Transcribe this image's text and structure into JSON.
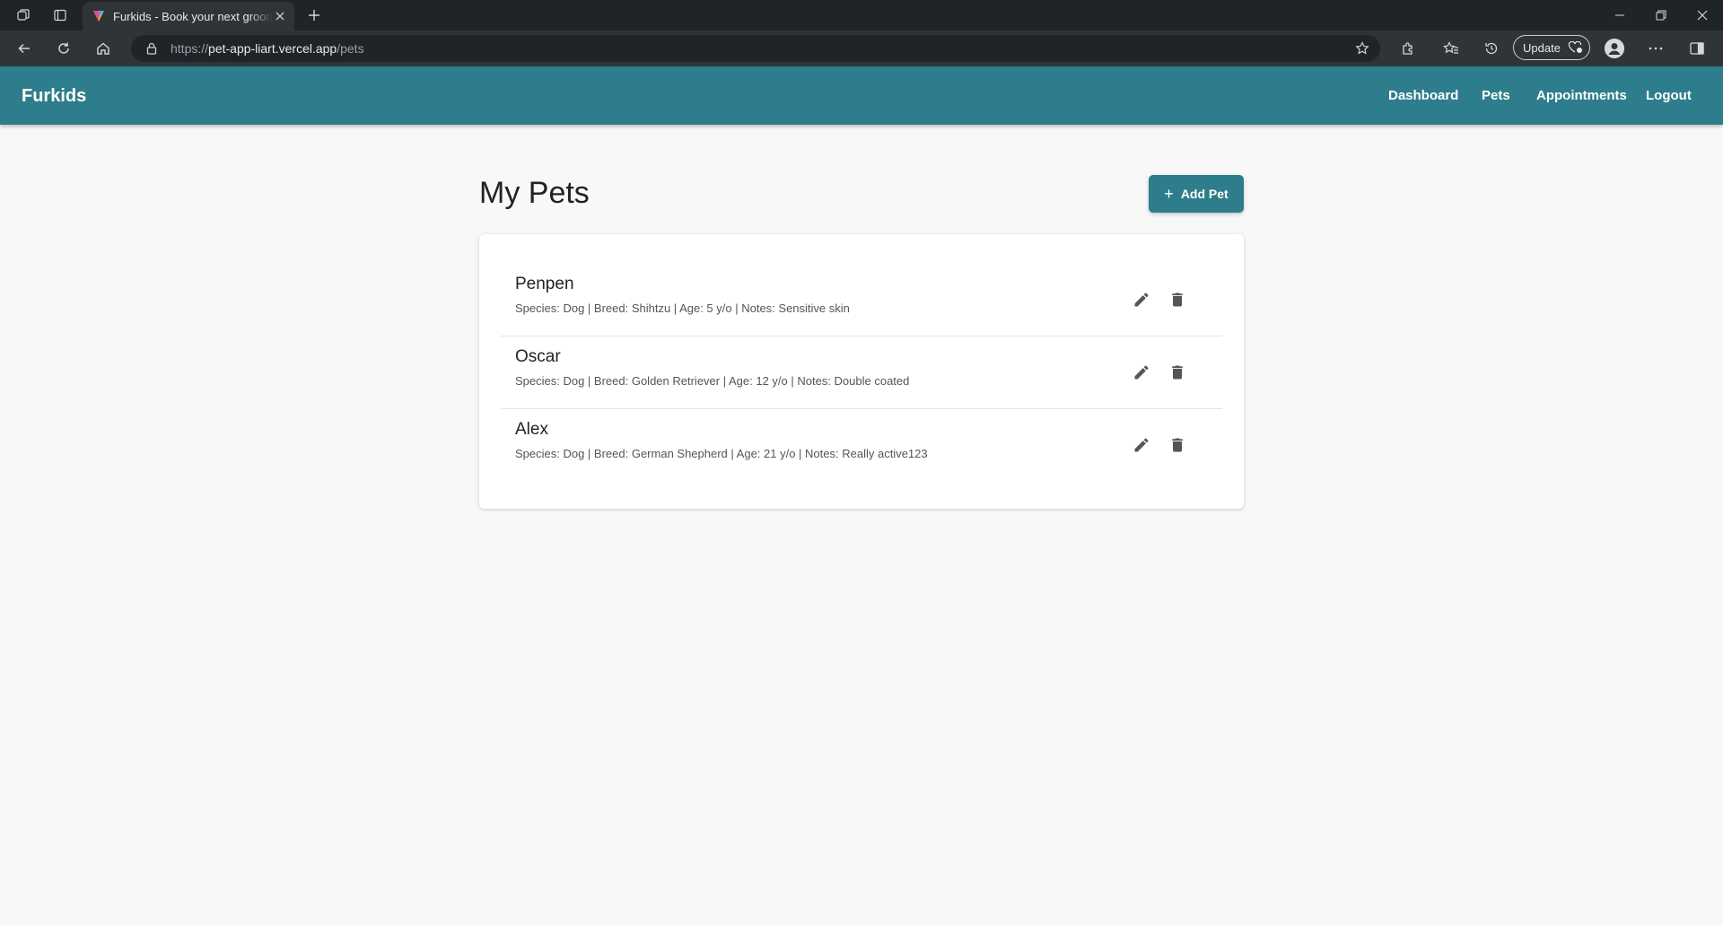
{
  "browser": {
    "tab_title": "Furkids - Book your next grooming appointment",
    "url_prefix": "https://",
    "url_host": "pet-app-liart.vercel.app",
    "url_path": "/pets",
    "update_label": "Update"
  },
  "navbar": {
    "brand": "Furkids",
    "links": [
      "Dashboard",
      "Pets",
      "Appointments",
      "Logout"
    ]
  },
  "page": {
    "title": "My Pets",
    "add_button_label": "Add Pet"
  },
  "pets": [
    {
      "name": "Penpen",
      "details": "Species: Dog | Breed: Shihtzu | Age: 5 y/o | Notes: Sensitive skin"
    },
    {
      "name": "Oscar",
      "details": "Species: Dog | Breed: Golden Retriever | Age: 12 y/o | Notes: Double coated"
    },
    {
      "name": "Alex",
      "details": "Species: Dog | Breed: German Shepherd | Age: 21 y/o | Notes: Really active123"
    }
  ],
  "colors": {
    "primary": "#2e7d8c",
    "background": "#f8f8f8",
    "icon": "#555555"
  }
}
